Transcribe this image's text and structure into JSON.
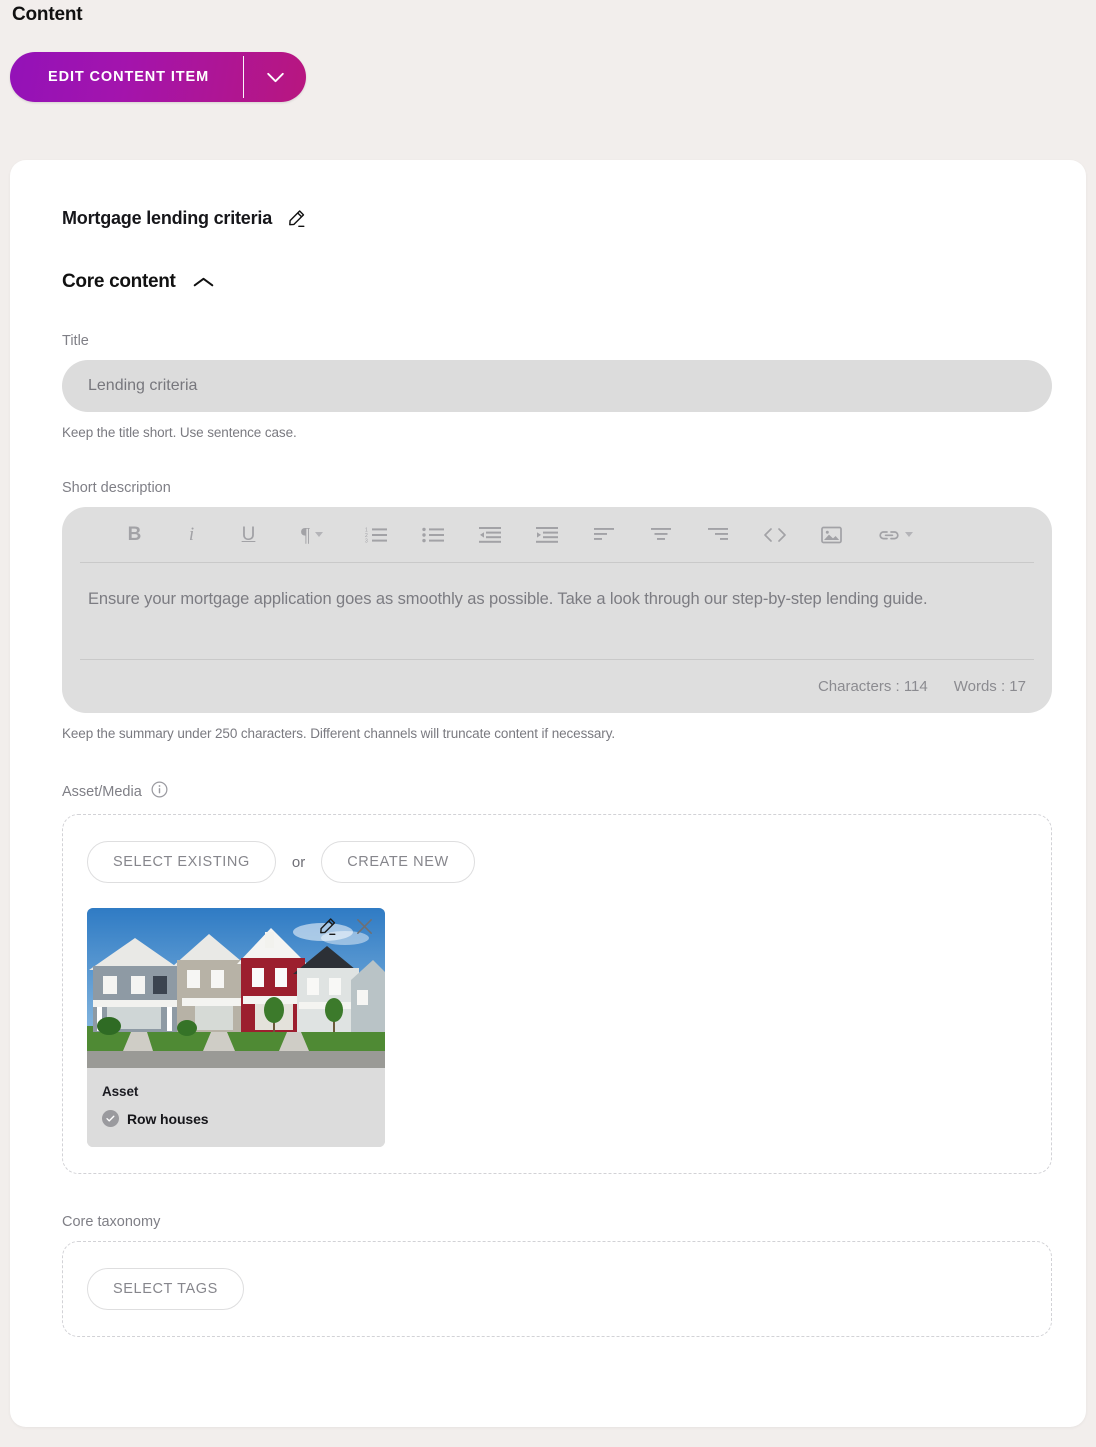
{
  "header": {
    "title": "Content",
    "primary_button": {
      "label": "EDIT CONTENT ITEM",
      "caret_icon": "chevron-down-icon",
      "gradient_start": "#9312b8",
      "gradient_end": "#b8167f"
    }
  },
  "item": {
    "title": "Mortgage lending criteria",
    "edit_icon": "pencil-icon"
  },
  "section": {
    "title": "Core content",
    "collapse_icon": "chevron-up-icon"
  },
  "title_field": {
    "label": "Title",
    "value": "Lending criteria",
    "placeholder": "Lending criteria",
    "helper": "Keep the title short. Use sentence case."
  },
  "short_description": {
    "label": "Short description",
    "body": "Ensure your mortgage application goes as smoothly as possible. Take a look through our step-by-step lending guide.",
    "characters_label": "Characters : 114",
    "words_label": "Words : 17",
    "helper": "Keep the summary under 250 characters. Different channels will truncate content if necessary.",
    "toolbar": [
      {
        "name": "bold-icon",
        "glyph": "B",
        "style": "bold",
        "caret": false
      },
      {
        "name": "italic-icon",
        "glyph": "i",
        "style": "italic",
        "caret": false
      },
      {
        "name": "underline-icon",
        "glyph": "U",
        "style": "underline",
        "caret": false
      },
      {
        "name": "paragraph-format-icon",
        "glyph": "¶",
        "style": "para",
        "caret": true
      },
      {
        "name": "ordered-list-icon",
        "glyph": "",
        "style": "svg-ol",
        "caret": false
      },
      {
        "name": "unordered-list-icon",
        "glyph": "",
        "style": "svg-ul",
        "caret": false
      },
      {
        "name": "outdent-icon",
        "glyph": "",
        "style": "svg-outdent",
        "caret": false
      },
      {
        "name": "indent-icon",
        "glyph": "",
        "style": "svg-indent",
        "caret": false
      },
      {
        "name": "align-left-icon",
        "glyph": "",
        "style": "svg-align-left",
        "caret": false
      },
      {
        "name": "align-center-icon",
        "glyph": "",
        "style": "svg-align-center",
        "caret": false
      },
      {
        "name": "align-right-icon",
        "glyph": "",
        "style": "svg-align-right",
        "caret": false
      },
      {
        "name": "code-icon",
        "glyph": "",
        "style": "svg-code",
        "caret": false
      },
      {
        "name": "insert-image-icon",
        "glyph": "",
        "style": "svg-image",
        "caret": false
      },
      {
        "name": "insert-link-icon",
        "glyph": "",
        "style": "svg-link",
        "caret": true
      }
    ]
  },
  "asset_media": {
    "label": "Asset/Media",
    "info_icon": "info-icon",
    "select_existing_label": "SELECT EXISTING",
    "or_label": "or",
    "create_new_label": "CREATE NEW",
    "asset": {
      "meta_label": "Asset",
      "name": "Row houses",
      "status_icon": "check-circle-icon",
      "edit_icon": "pencil-icon",
      "remove_icon": "close-icon",
      "image_alt": "row-houses-photo"
    }
  },
  "core_taxonomy": {
    "label": "Core taxonomy",
    "select_tags_label": "SELECT TAGS"
  }
}
